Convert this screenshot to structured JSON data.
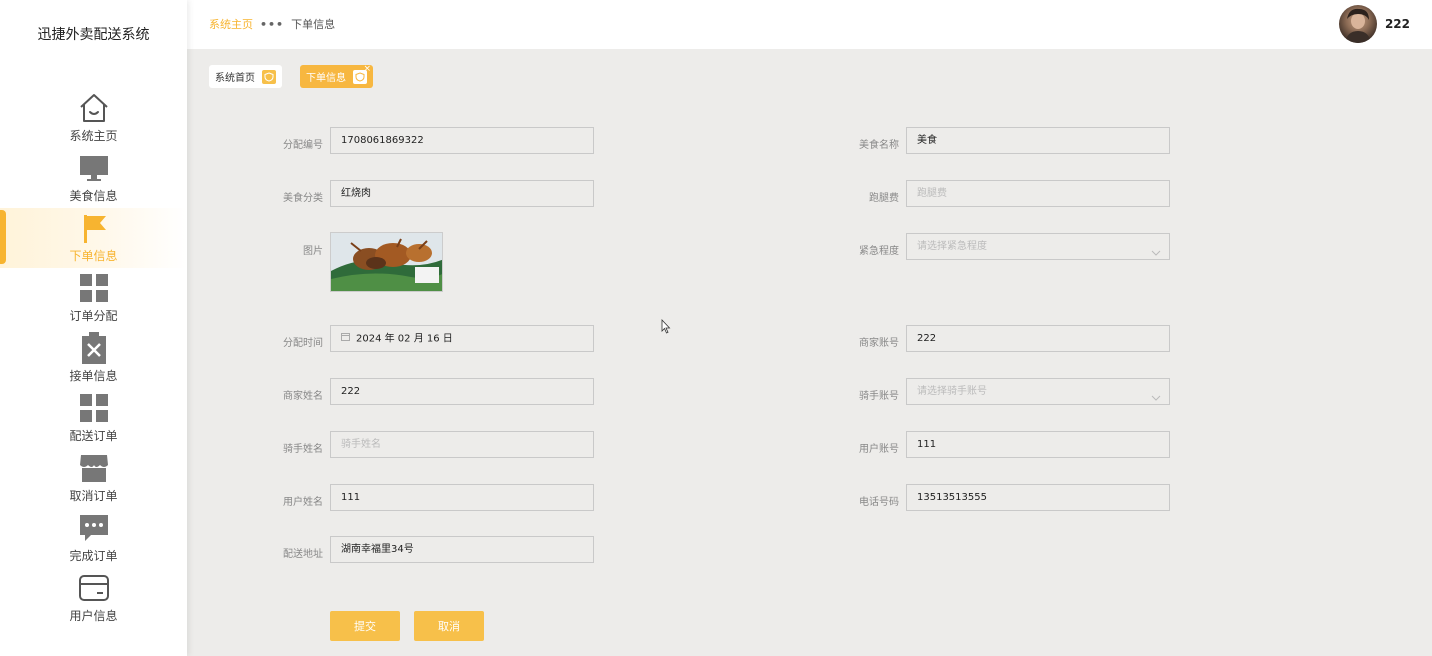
{
  "app": {
    "title": "迅捷外卖配送系统"
  },
  "sidebar": {
    "items": [
      {
        "label": "系统主页",
        "icon": "home-icon"
      },
      {
        "label": "美食信息",
        "icon": "monitor-icon"
      },
      {
        "label": "下单信息",
        "icon": "flag-icon",
        "active": true
      },
      {
        "label": "订单分配",
        "icon": "grid-icon"
      },
      {
        "label": "接单信息",
        "icon": "clipboard-x-icon"
      },
      {
        "label": "配送订单",
        "icon": "grid-icon"
      },
      {
        "label": "取消订单",
        "icon": "store-icon"
      },
      {
        "label": "完成订单",
        "icon": "chat-icon"
      },
      {
        "label": "用户信息",
        "icon": "card-icon"
      }
    ]
  },
  "header": {
    "breadcrumb_home": "系统主页",
    "breadcrumb_sep": "•••",
    "breadcrumb_current": "下单信息",
    "username": "222"
  },
  "tabs": [
    {
      "label": "系统首页"
    },
    {
      "label": "下单信息",
      "close": "×"
    }
  ],
  "form": {
    "dispatch_no": {
      "label": "分配编号",
      "value": "1708061869322"
    },
    "food_name": {
      "label": "美食名称",
      "value": "美食"
    },
    "food_category": {
      "label": "美食分类",
      "value": "红烧肉"
    },
    "delivery_fee": {
      "label": "跑腿费",
      "placeholder": "跑腿费"
    },
    "picture": {
      "label": "图片"
    },
    "urgency": {
      "label": "紧急程度",
      "placeholder": "请选择紧急程度"
    },
    "dispatch_time": {
      "label": "分配时间",
      "value": "2024 年 02 月 16 日"
    },
    "merchant_account": {
      "label": "商家账号",
      "value": "222"
    },
    "merchant_name": {
      "label": "商家姓名",
      "value": "222"
    },
    "rider_account": {
      "label": "骑手账号",
      "placeholder": "请选择骑手账号"
    },
    "rider_name": {
      "label": "骑手姓名",
      "placeholder": "骑手姓名"
    },
    "user_account": {
      "label": "用户账号",
      "value": "111"
    },
    "user_name": {
      "label": "用户姓名",
      "value": "111"
    },
    "phone": {
      "label": "电话号码",
      "value": "13513513555"
    },
    "address": {
      "label": "配送地址",
      "value": "湖南幸福里34号"
    }
  },
  "buttons": {
    "submit": "提交",
    "cancel": "取消"
  },
  "colors": {
    "accent": "#f7b430",
    "background": "#edecea",
    "sidebar": "#ffffff"
  }
}
